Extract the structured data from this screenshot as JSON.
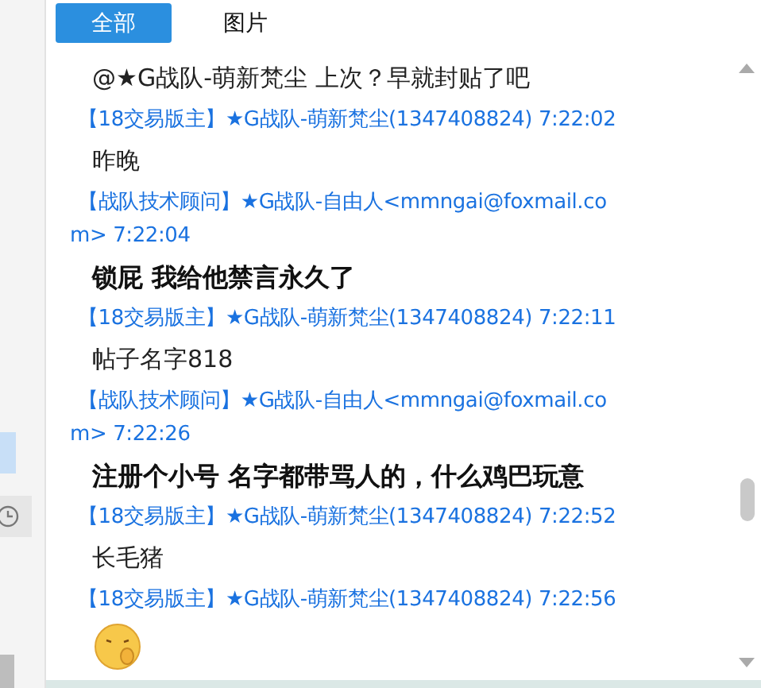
{
  "tabs": [
    {
      "label": "全部",
      "selected": true
    },
    {
      "label": "图片",
      "selected": false
    }
  ],
  "messages": [
    {
      "kind": "text",
      "text": "@★G战队-萌新梵尘 上次？早就封贴了吧",
      "bold": false
    },
    {
      "kind": "meta",
      "lines": [
        "【18交易版主】★G战队-萌新梵尘(1347408824) 7:22:02"
      ]
    },
    {
      "kind": "text",
      "text": "昨晚",
      "bold": false
    },
    {
      "kind": "meta",
      "lines": [
        "【战队技术顾问】★G战队-自由人<mmngai@foxmail.co",
        "m> 7:22:04"
      ]
    },
    {
      "kind": "text",
      "text": "锁屁 我给他禁言永久了",
      "bold": true
    },
    {
      "kind": "meta",
      "lines": [
        "【18交易版主】★G战队-萌新梵尘(1347408824) 7:22:11"
      ]
    },
    {
      "kind": "text",
      "text": "帖子名字818",
      "bold": false
    },
    {
      "kind": "meta",
      "lines": [
        "【战队技术顾问】★G战队-自由人<mmngai@foxmail.co",
        "m> 7:22:26"
      ]
    },
    {
      "kind": "text",
      "text": "注册个小号 名字都带骂人的，什么鸡巴玩意",
      "bold": true
    },
    {
      "kind": "meta",
      "lines": [
        "【18交易版主】★G战队-萌新梵尘(1347408824) 7:22:52"
      ]
    },
    {
      "kind": "text",
      "text": "长毛猪",
      "bold": false
    },
    {
      "kind": "meta",
      "lines": [
        "【18交易版主】★G战队-萌新梵尘(1347408824) 7:22:56"
      ]
    },
    {
      "kind": "emoji"
    }
  ]
}
